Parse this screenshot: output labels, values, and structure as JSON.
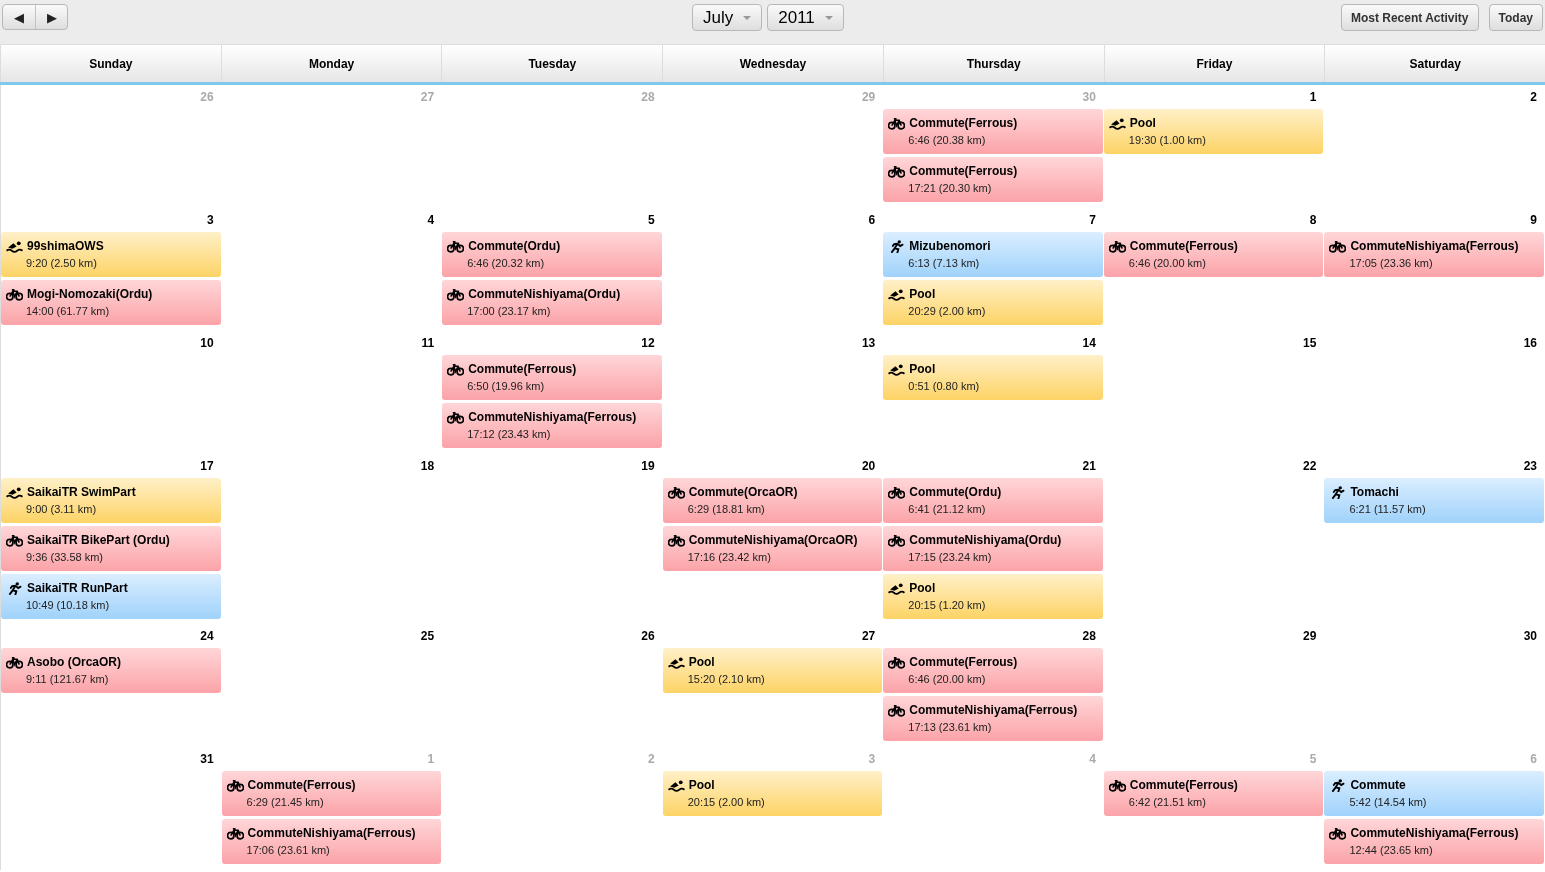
{
  "toolbar": {
    "prev": "◀",
    "next": "▶",
    "month": "July",
    "year": "2011",
    "buttons": [
      "Most Recent Activity",
      "Today"
    ]
  },
  "weekdays": [
    "Sunday",
    "Monday",
    "Tuesday",
    "Wednesday",
    "Thursday",
    "Friday",
    "Saturday"
  ],
  "weeks": [
    [
      {
        "day": "26",
        "other_month": true
      },
      {
        "day": "27",
        "other_month": true
      },
      {
        "day": "28",
        "other_month": true
      },
      {
        "day": "29",
        "other_month": true
      },
      {
        "day": "30",
        "other_month": true,
        "events": [
          {
            "kind": "bike",
            "title": "Commute(Ferrous)",
            "detail": "6:46 (20.38 km)"
          },
          {
            "kind": "bike",
            "title": "Commute(Ferrous)",
            "detail": "17:21 (20.30 km)"
          }
        ]
      },
      {
        "day": "1",
        "other_month": false,
        "events": [
          {
            "kind": "swim",
            "title": "Pool",
            "detail": "19:30 (1.00 km)"
          }
        ]
      },
      {
        "day": "2",
        "other_month": false
      }
    ],
    [
      {
        "day": "3",
        "other_month": false,
        "events": [
          {
            "kind": "swim",
            "title": "99shimaOWS",
            "detail": "9:20 (2.50 km)"
          },
          {
            "kind": "bike",
            "title": "Mogi-Nomozaki(Ordu)",
            "detail": "14:00 (61.77 km)"
          }
        ]
      },
      {
        "day": "4",
        "other_month": false
      },
      {
        "day": "5",
        "other_month": false,
        "events": [
          {
            "kind": "bike",
            "title": "Commute(Ordu)",
            "detail": "6:46 (20.32 km)"
          },
          {
            "kind": "bike",
            "title": "CommuteNishiyama(Ordu)",
            "detail": "17:00 (23.17 km)"
          }
        ]
      },
      {
        "day": "6",
        "other_month": false
      },
      {
        "day": "7",
        "other_month": false,
        "events": [
          {
            "kind": "run",
            "title": "Mizubenomori",
            "detail": "6:13 (7.13 km)"
          },
          {
            "kind": "swim",
            "title": "Pool",
            "detail": "20:29 (2.00 km)"
          }
        ]
      },
      {
        "day": "8",
        "other_month": false,
        "events": [
          {
            "kind": "bike",
            "title": "Commute(Ferrous)",
            "detail": "6:46 (20.00 km)"
          }
        ]
      },
      {
        "day": "9",
        "other_month": false,
        "events": [
          {
            "kind": "bike",
            "title": "CommuteNishiyama(Ferrous)",
            "detail": "17:05 (23.36 km)"
          }
        ]
      }
    ],
    [
      {
        "day": "10",
        "other_month": false
      },
      {
        "day": "11",
        "other_month": false
      },
      {
        "day": "12",
        "other_month": false,
        "events": [
          {
            "kind": "bike",
            "title": "Commute(Ferrous)",
            "detail": "6:50 (19.96 km)"
          },
          {
            "kind": "bike",
            "title": "CommuteNishiyama(Ferrous)",
            "detail": "17:12 (23.43 km)"
          }
        ]
      },
      {
        "day": "13",
        "other_month": false
      },
      {
        "day": "14",
        "other_month": false,
        "events": [
          {
            "kind": "swim",
            "title": "Pool",
            "detail": "0:51 (0.80 km)"
          }
        ]
      },
      {
        "day": "15",
        "other_month": false
      },
      {
        "day": "16",
        "other_month": false
      }
    ],
    [
      {
        "day": "17",
        "other_month": false,
        "events": [
          {
            "kind": "swim",
            "title": "SaikaiTR SwimPart",
            "detail": "9:00 (3.11 km)"
          },
          {
            "kind": "bike",
            "title": "SaikaiTR BikePart (Ordu)",
            "detail": "9:36 (33.58 km)"
          },
          {
            "kind": "run",
            "title": "SaikaiTR RunPart",
            "detail": "10:49 (10.18 km)"
          }
        ]
      },
      {
        "day": "18",
        "other_month": false
      },
      {
        "day": "19",
        "other_month": false
      },
      {
        "day": "20",
        "other_month": false,
        "events": [
          {
            "kind": "bike",
            "title": "Commute(OrcaOR)",
            "detail": "6:29 (18.81 km)"
          },
          {
            "kind": "bike",
            "title": "CommuteNishiyama(OrcaOR)",
            "detail": "17:16 (23.42 km)"
          }
        ]
      },
      {
        "day": "21",
        "other_month": false,
        "events": [
          {
            "kind": "bike",
            "title": "Commute(Ordu)",
            "detail": "6:41 (21.12 km)"
          },
          {
            "kind": "bike",
            "title": "CommuteNishiyama(Ordu)",
            "detail": "17:15 (23.24 km)"
          },
          {
            "kind": "swim",
            "title": "Pool",
            "detail": "20:15 (1.20 km)"
          }
        ]
      },
      {
        "day": "22",
        "other_month": false
      },
      {
        "day": "23",
        "other_month": false,
        "events": [
          {
            "kind": "run",
            "title": "Tomachi",
            "detail": "6:21 (11.57 km)"
          }
        ]
      }
    ],
    [
      {
        "day": "24",
        "other_month": false,
        "events": [
          {
            "kind": "bike",
            "title": "Asobo (OrcaOR)",
            "detail": "9:11 (121.67 km)"
          }
        ]
      },
      {
        "day": "25",
        "other_month": false
      },
      {
        "day": "26",
        "other_month": false
      },
      {
        "day": "27",
        "other_month": false,
        "events": [
          {
            "kind": "swim",
            "title": "Pool",
            "detail": "15:20 (2.10 km)"
          }
        ]
      },
      {
        "day": "28",
        "other_month": false,
        "events": [
          {
            "kind": "bike",
            "title": "Commute(Ferrous)",
            "detail": "6:46 (20.00 km)"
          },
          {
            "kind": "bike",
            "title": "CommuteNishiyama(Ferrous)",
            "detail": "17:13 (23.61 km)"
          }
        ]
      },
      {
        "day": "29",
        "other_month": false
      },
      {
        "day": "30",
        "other_month": false
      }
    ],
    [
      {
        "day": "31",
        "other_month": false
      },
      {
        "day": "1",
        "other_month": true,
        "events": [
          {
            "kind": "bike",
            "title": "Commute(Ferrous)",
            "detail": "6:29 (21.45 km)"
          },
          {
            "kind": "bike",
            "title": "CommuteNishiyama(Ferrous)",
            "detail": "17:06 (23.61 km)"
          }
        ]
      },
      {
        "day": "2",
        "other_month": true
      },
      {
        "day": "3",
        "other_month": true,
        "events": [
          {
            "kind": "swim",
            "title": "Pool",
            "detail": "20:15 (2.00 km)"
          }
        ]
      },
      {
        "day": "4",
        "other_month": true
      },
      {
        "day": "5",
        "other_month": true,
        "events": [
          {
            "kind": "bike",
            "title": "Commute(Ferrous)",
            "detail": "6:42 (21.51 km)"
          }
        ]
      },
      {
        "day": "6",
        "other_month": true,
        "events": [
          {
            "kind": "run",
            "title": "Commute",
            "detail": "5:42 (14.54 km)"
          },
          {
            "kind": "bike",
            "title": "CommuteNishiyama(Ferrous)",
            "detail": "12:44 (23.65 km)"
          }
        ]
      }
    ]
  ]
}
